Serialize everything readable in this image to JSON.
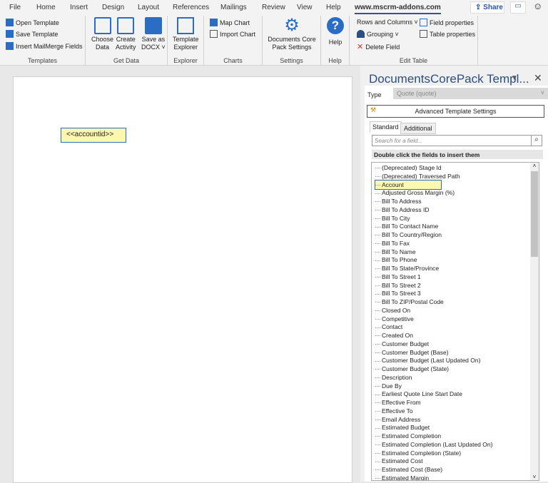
{
  "tabs": [
    "File",
    "Home",
    "Insert",
    "Design",
    "Layout",
    "References",
    "Mailings",
    "Review",
    "View",
    "Help",
    "www.mscrm-addons.com"
  ],
  "share": "Share",
  "groups": {
    "templates": {
      "label": "Templates",
      "items": [
        "Open Template",
        "Save Template",
        "Insert MailMerge Fields"
      ]
    },
    "getdata": {
      "label": "Get Data",
      "choose": [
        "Choose",
        "Data"
      ],
      "create": [
        "Create",
        "Activity"
      ],
      "save": [
        "Save as",
        "DOCX ˅"
      ]
    },
    "explorer": {
      "label": "Explorer",
      "btn": [
        "Template",
        "Explorer"
      ]
    },
    "charts": {
      "label": "Charts",
      "items": [
        "Map Chart",
        "Import Chart"
      ]
    },
    "settings": {
      "label": "Settings",
      "btn": [
        "Documents Core",
        "Pack Settings"
      ]
    },
    "help": {
      "label": "Help",
      "btn": "Help"
    },
    "edittable": {
      "label": "Edit Table",
      "rows": "Rows and Columns ˅",
      "grouping": "Grouping ˅",
      "delete": "Delete Field",
      "fieldprops": "Field properties",
      "tableprops": "Table properties"
    }
  },
  "document": {
    "field": "<<accountid>>"
  },
  "pane": {
    "title": "DocumentsCorePack Templ...",
    "type_label": "Type",
    "type_value": "Quote (quote)",
    "advanced": "Advanced Template Settings",
    "tab_standard": "Standard",
    "tab_additional": "Additional",
    "search_placeholder": "Search for a field...",
    "hint": "Double click the fields to insert them",
    "fields": [
      "(Deprecated) Stage Id",
      "(Deprecated) Traversed Path",
      "Account",
      "Adjusted Gross Margin (%)",
      "Bill To Address",
      "Bill To Address ID",
      "Bill To City",
      "Bill To Contact Name",
      "Bill To Country/Region",
      "Bill To Fax",
      "Bill To Name",
      "Bill To Phone",
      "Bill To State/Province",
      "Bill To Street 1",
      "Bill To Street 2",
      "Bill To Street 3",
      "Bill To ZIP/Postal Code",
      "Closed On",
      "Competitive",
      "Contact",
      "Created On",
      "Customer Budget",
      "Customer Budget (Base)",
      "Customer Budget (Last Updated On)",
      "Customer Budget (State)",
      "Description",
      "Due By",
      "Earliest Quote Line Start Date",
      "Effective From",
      "Effective To",
      "Email Address",
      "Estimated Budget",
      "Estimated Completion",
      "Estimated Completion (Last Updated On)",
      "Estimated Completion (State)",
      "Estimated Cost",
      "Estimated Cost (Base)",
      "Estimated Margin"
    ],
    "selected_index": 2
  }
}
